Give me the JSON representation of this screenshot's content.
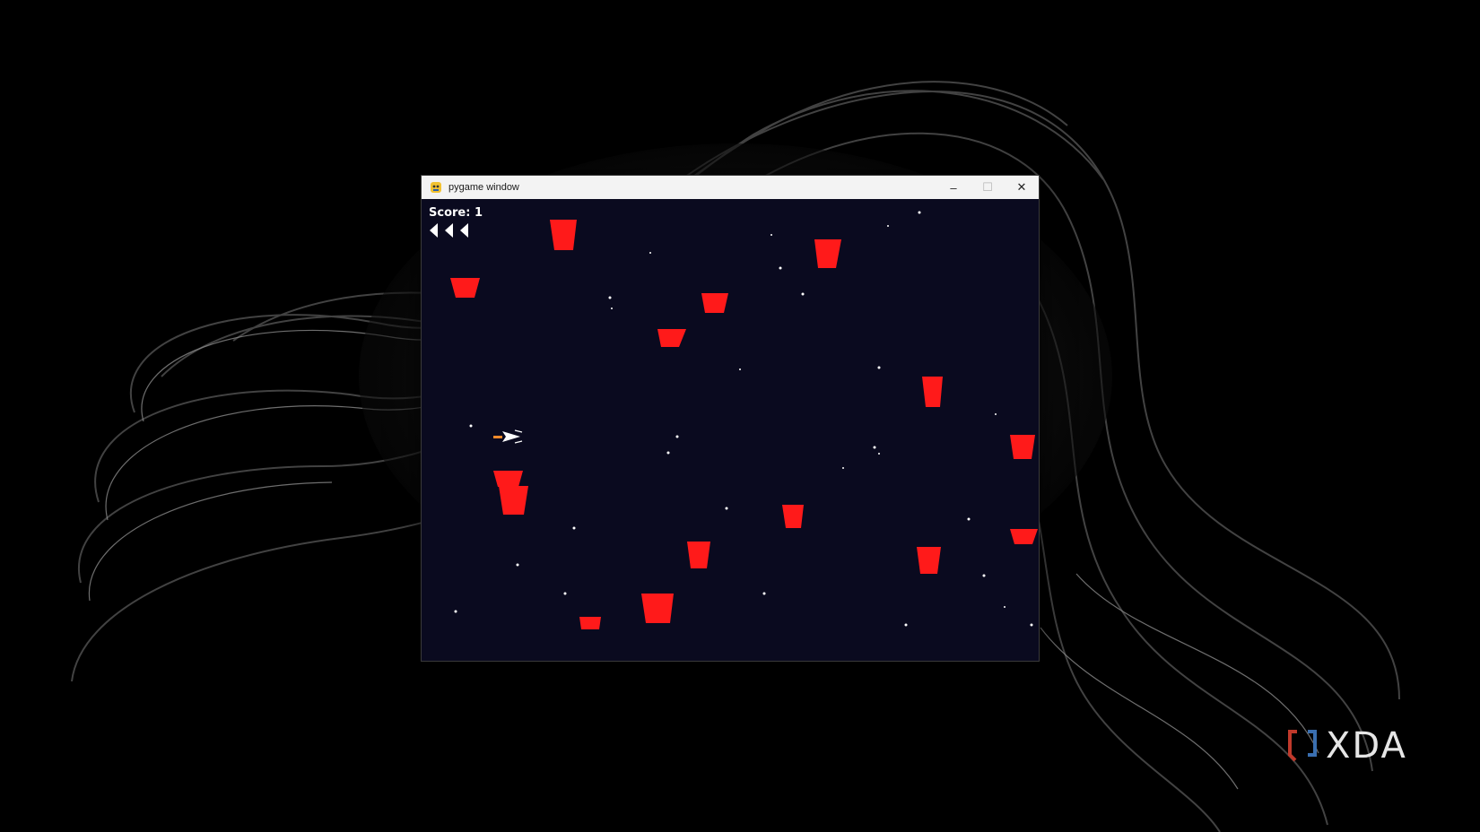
{
  "window": {
    "title": "pygame window",
    "controls": {
      "minimize": "–",
      "maximize": "☐",
      "close": "✕"
    }
  },
  "game": {
    "score_text": "Score: 1",
    "lives": 3,
    "colors": {
      "background": "#0a0a1f",
      "obstacle": "#ff1a1a",
      "star": "#ffffff"
    }
  },
  "watermark": {
    "text": "XDA"
  }
}
